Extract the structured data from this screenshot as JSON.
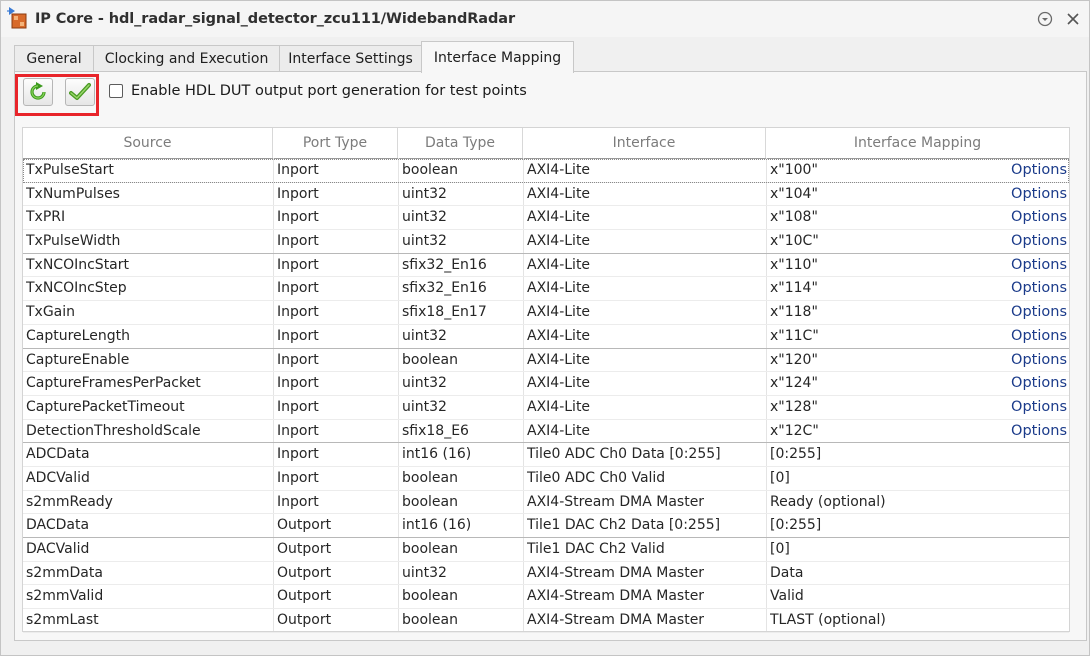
{
  "window": {
    "title": "IP Core - hdl_radar_signal_detector_zcu111/WidebandRadar",
    "icon": "simulink-block-icon",
    "menu_icon": "chevron-down-circle-icon",
    "close_icon": "close-icon"
  },
  "tabs": [
    {
      "label": "General"
    },
    {
      "label": "Clocking and Execution"
    },
    {
      "label": "Interface Settings"
    },
    {
      "label": "Interface Mapping"
    }
  ],
  "toolbar": {
    "refresh_icon": "refresh-icon",
    "apply_icon": "checkmark-icon",
    "highlight_color": "#e8242a",
    "checkbox_label": "Enable HDL DUT output port generation for test points",
    "checkbox_checked": false
  },
  "table": {
    "columns": [
      "Source",
      "Port Type",
      "Data Type",
      "Interface",
      "Interface Mapping"
    ],
    "options_label": "Options",
    "rows": [
      {
        "source": "TxPulseStart",
        "port": "Inport",
        "dtype": "boolean",
        "iface": "AXI4-Lite",
        "map": "x\"100\"",
        "options": true
      },
      {
        "source": "TxNumPulses",
        "port": "Inport",
        "dtype": "uint32",
        "iface": "AXI4-Lite",
        "map": "x\"104\"",
        "options": true
      },
      {
        "source": "TxPRI",
        "port": "Inport",
        "dtype": "uint32",
        "iface": "AXI4-Lite",
        "map": "x\"108\"",
        "options": true
      },
      {
        "source": "TxPulseWidth",
        "port": "Inport",
        "dtype": "uint32",
        "iface": "AXI4-Lite",
        "map": "x\"10C\"",
        "options": true
      },
      {
        "source": "TxNCOIncStart",
        "port": "Inport",
        "dtype": "sfix32_En16",
        "iface": "AXI4-Lite",
        "map": "x\"110\"",
        "options": true
      },
      {
        "source": "TxNCOIncStep",
        "port": "Inport",
        "dtype": "sfix32_En16",
        "iface": "AXI4-Lite",
        "map": "x\"114\"",
        "options": true
      },
      {
        "source": "TxGain",
        "port": "Inport",
        "dtype": "sfix18_En17",
        "iface": "AXI4-Lite",
        "map": "x\"118\"",
        "options": true
      },
      {
        "source": "CaptureLength",
        "port": "Inport",
        "dtype": "uint32",
        "iface": "AXI4-Lite",
        "map": "x\"11C\"",
        "options": true
      },
      {
        "source": "CaptureEnable",
        "port": "Inport",
        "dtype": "boolean",
        "iface": "AXI4-Lite",
        "map": "x\"120\"",
        "options": true
      },
      {
        "source": "CaptureFramesPerPacket",
        "port": "Inport",
        "dtype": "uint32",
        "iface": "AXI4-Lite",
        "map": "x\"124\"",
        "options": true
      },
      {
        "source": "CapturePacketTimeout",
        "port": "Inport",
        "dtype": "uint32",
        "iface": "AXI4-Lite",
        "map": "x\"128\"",
        "options": true
      },
      {
        "source": "DetectionThresholdScale",
        "port": "Inport",
        "dtype": "sfix18_E6",
        "iface": "AXI4-Lite",
        "map": "x\"12C\"",
        "options": true
      },
      {
        "source": "ADCData",
        "port": "Inport",
        "dtype": "int16 (16)",
        "iface": "Tile0 ADC Ch0 Data [0:255]",
        "map": "[0:255]",
        "options": false
      },
      {
        "source": "ADCValid",
        "port": "Inport",
        "dtype": "boolean",
        "iface": "Tile0 ADC Ch0 Valid",
        "map": "[0]",
        "options": false
      },
      {
        "source": "s2mmReady",
        "port": "Inport",
        "dtype": "boolean",
        "iface": "AXI4-Stream DMA Master",
        "map": "Ready (optional)",
        "options": false
      },
      {
        "source": "DACData",
        "port": "Outport",
        "dtype": "int16 (16)",
        "iface": "Tile1 DAC Ch2 Data [0:255]",
        "map": "[0:255]",
        "options": false
      },
      {
        "source": "DACValid",
        "port": "Outport",
        "dtype": "boolean",
        "iface": "Tile1 DAC Ch2 Valid",
        "map": "[0]",
        "options": false
      },
      {
        "source": "s2mmData",
        "port": "Outport",
        "dtype": "uint32",
        "iface": "AXI4-Stream DMA Master",
        "map": "Data",
        "options": false
      },
      {
        "source": "s2mmValid",
        "port": "Outport",
        "dtype": "boolean",
        "iface": "AXI4-Stream DMA Master",
        "map": "Valid",
        "options": false
      },
      {
        "source": "s2mmLast",
        "port": "Outport",
        "dtype": "boolean",
        "iface": "AXI4-Stream DMA Master",
        "map": "TLAST (optional)",
        "options": false
      }
    ]
  }
}
